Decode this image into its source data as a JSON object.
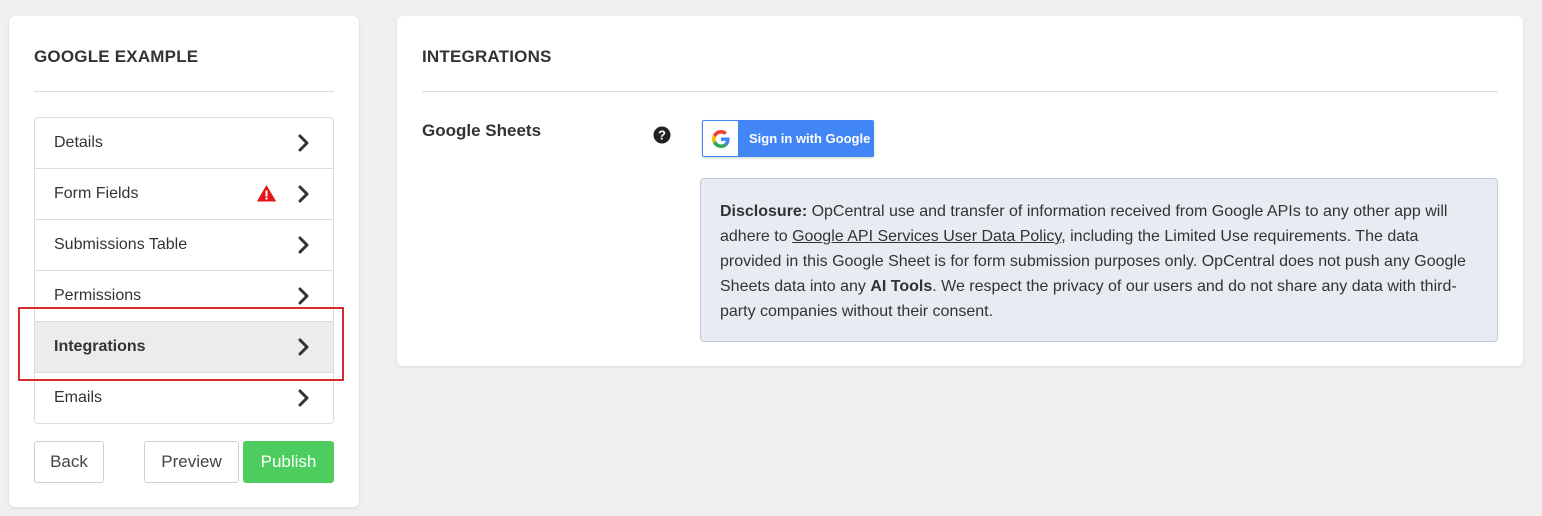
{
  "sidebar": {
    "title": "GOOGLE EXAMPLE",
    "items": [
      {
        "label": "Details"
      },
      {
        "label": "Form Fields",
        "warning": true
      },
      {
        "label": "Submissions Table"
      },
      {
        "label": "Permissions"
      },
      {
        "label": "Integrations",
        "active": true
      },
      {
        "label": "Emails"
      }
    ],
    "buttons": {
      "back": "Back",
      "preview": "Preview",
      "publish": "Publish"
    }
  },
  "integrations": {
    "title": "INTEGRATIONS",
    "google_sheets_label": "Google Sheets",
    "google_signin_label": "Sign in with Google",
    "disclosure": {
      "lead": "Disclosure:",
      "text1": " OpCentral use and transfer of information received from Google APIs to any other app will adhere to ",
      "link": "Google API Services User Data Policy",
      "text2": ", including the Limited Use requirements. The data provided in this Google Sheet is for form submission purposes only. OpCentral does not push any Google Sheets data into any ",
      "bold2": "AI Tools",
      "text3": ". We respect the privacy of our users and do not share any data with third-party companies without their consent."
    }
  },
  "colors": {
    "publish": "#4ccd5e",
    "google_blue": "#4285f4",
    "highlight": "#d92b2b",
    "warning": "#e0161b"
  }
}
